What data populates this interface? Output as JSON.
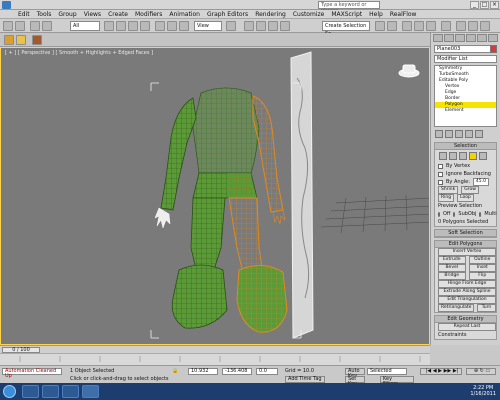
{
  "titlebar": {
    "search_placeholder": "Type a keyword or phrase"
  },
  "menu": [
    "Edit",
    "Tools",
    "Group",
    "Views",
    "Create",
    "Modifiers",
    "Animation",
    "Graph Editors",
    "Rendering",
    "Customize",
    "MAXScript",
    "Help",
    "RealFlow"
  ],
  "toolbar": {
    "filter_value": "All",
    "refcoord_value": "View",
    "selection_set_placeholder": "Create Selection Se"
  },
  "viewport": {
    "label": "[ + ] [ Perspective ] [ Smooth + Highlights + Edged Faces ]"
  },
  "command_panel": {
    "object_name": "Plane003",
    "modifier_list": "Modifier List",
    "stack": [
      "Symmetry",
      "TurboSmooth",
      "Editable Poly",
      "Vertex",
      "Edge",
      "Border",
      "Polygon",
      "Element"
    ],
    "stack_selected": "Polygon",
    "selection": {
      "title": "Selection",
      "by_vertex": "By Vertex",
      "ignore_backfacing": "Ignore Backfacing",
      "by_angle": "By Angle:",
      "angle_value": "45.0",
      "shrink": "Shrink",
      "grow": "Grow",
      "ring": "Ring",
      "loop": "Loop",
      "preview_selection": "Preview Selection",
      "preview_off": "Off",
      "preview_subobj": "SubObj",
      "preview_multi": "Multi",
      "status": "0 Polygons Selected"
    },
    "soft_selection": "Soft Selection",
    "edit_polygons": {
      "title": "Edit Polygons",
      "insert_vertex": "Insert Vertex",
      "extrude": "Extrude",
      "outline": "Outline",
      "bevel": "Bevel",
      "inset": "Inset",
      "bridge": "Bridge",
      "flip": "Flip",
      "hinge": "Hinge From Edge",
      "extrude_spline": "Extrude Along Spline",
      "edit_triangulation": "Edit Triangulation",
      "retriangulate": "Retriangulate",
      "turn": "Turn"
    },
    "edit_geometry": {
      "title": "Edit Geometry",
      "repeat_last": "Repeat Last",
      "constraints": "Constraints"
    }
  },
  "timeline": {
    "frame": "0 / 100"
  },
  "status": {
    "maxscript": "Automation Cleaned Up",
    "objects": "1 Object Selected",
    "prompt": "Click or click-and-drag to select objects",
    "x": "10.932",
    "y": "-136.408",
    "z": "0.0",
    "grid": "Grid = 10.0",
    "add_time_tag": "Add Time Tag",
    "auto_key": "Auto Key",
    "set_key": "Set Key",
    "selected": "Selected",
    "key_filters": "Key Filters..."
  },
  "clock": {
    "time": "2:22 PM",
    "date": "1/16/2011"
  },
  "colors": {
    "accent": "#f6e400",
    "wire_green": "#4d8a2e",
    "wire_orange": "#e08a1e",
    "viewport_bg": "#7a7a7a"
  }
}
